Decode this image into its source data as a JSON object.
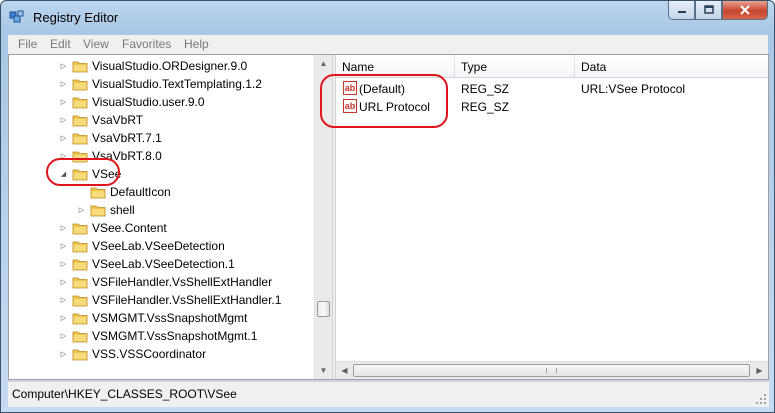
{
  "window": {
    "title": "Registry Editor"
  },
  "menu": [
    "File",
    "Edit",
    "View",
    "Favorites",
    "Help"
  ],
  "tree": {
    "items": [
      {
        "label": "VisualStudio.ORDesigner.9.0",
        "expander": "collapsed"
      },
      {
        "label": "VisualStudio.TextTemplating.1.2",
        "expander": "collapsed"
      },
      {
        "label": "VisualStudio.user.9.0",
        "expander": "collapsed"
      },
      {
        "label": "VsaVbRT",
        "expander": "collapsed"
      },
      {
        "label": "VsaVbRT.7.1",
        "expander": "collapsed"
      },
      {
        "label": "VsaVbRT.8.0",
        "expander": "collapsed"
      },
      {
        "label": "VSee",
        "expander": "expanded"
      },
      {
        "label": "DefaultIcon",
        "expander": "none"
      },
      {
        "label": "shell",
        "expander": "collapsed"
      },
      {
        "label": "VSee.Content",
        "expander": "collapsed"
      },
      {
        "label": "VSeeLab.VSeeDetection",
        "expander": "collapsed"
      },
      {
        "label": "VSeeLab.VSeeDetection.1",
        "expander": "collapsed"
      },
      {
        "label": "VSFileHandler.VsShellExtHandler",
        "expander": "collapsed"
      },
      {
        "label": "VSFileHandler.VsShellExtHandler.1",
        "expander": "collapsed"
      },
      {
        "label": "VSMGMT.VssSnapshotMgmt",
        "expander": "collapsed"
      },
      {
        "label": "VSMGMT.VssSnapshotMgmt.1",
        "expander": "collapsed"
      },
      {
        "label": "VSS.VSSCoordinator",
        "expander": "collapsed"
      }
    ]
  },
  "list": {
    "columns": [
      "Name",
      "Type",
      "Data"
    ],
    "rows": [
      {
        "name": "(Default)",
        "type": "REG_SZ",
        "data": "URL:VSee Protocol",
        "icon": "ab-string-icon"
      },
      {
        "name": "URL Protocol",
        "type": "REG_SZ",
        "data": "",
        "icon": "ab-string-icon"
      }
    ]
  },
  "status": {
    "path": "Computer\\HKEY_CLASSES_ROOT\\VSee"
  },
  "colors": {
    "annotation": "#e0151b",
    "folder": "#f0c54a"
  }
}
